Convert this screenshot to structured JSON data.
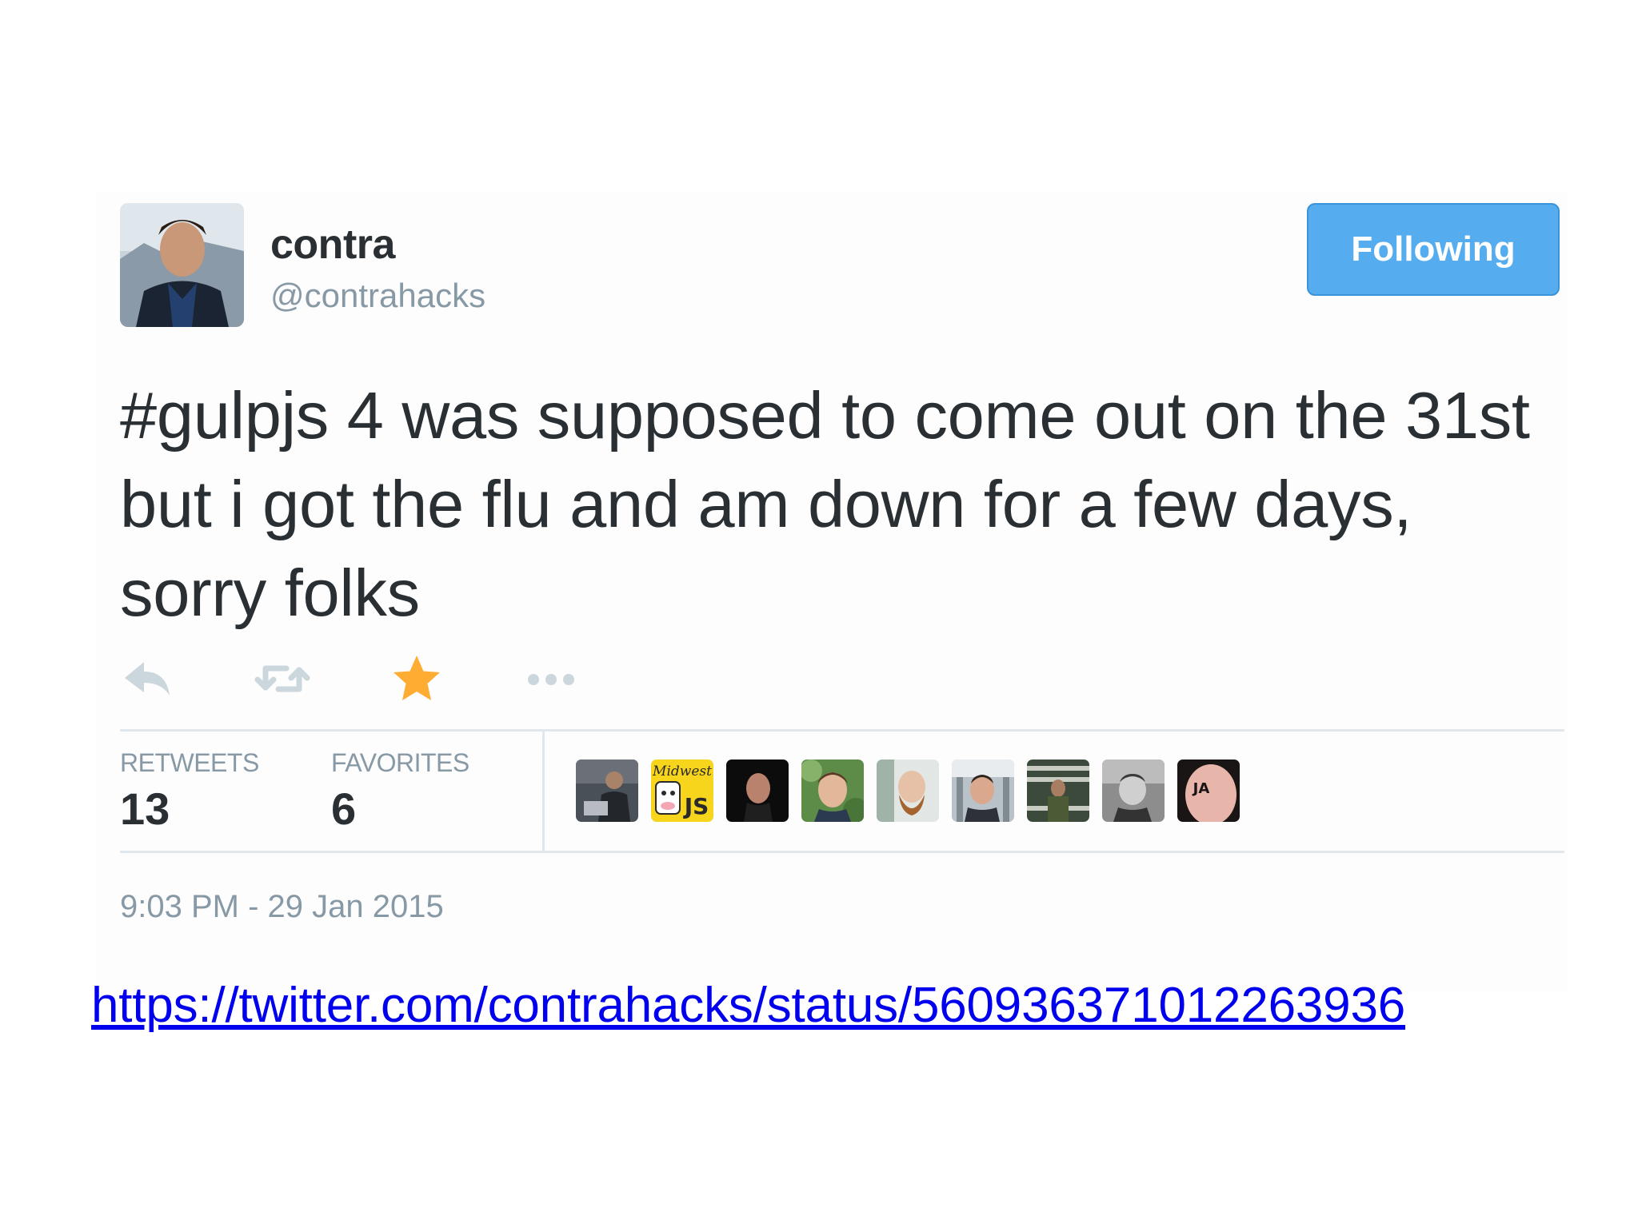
{
  "user": {
    "fullname": "contra",
    "screenname": "@contrahacks",
    "follow_button_label": "Following",
    "settings_icon": "gear-icon",
    "avatar_icon": "profile-avatar"
  },
  "tweet": {
    "hashtag": "#gulpjs",
    "text_rest": " 4 was supposed to come out on the 31st but i got the flu and am down for a few days, sorry folks",
    "timestamp": "9:03 PM - 29 Jan 2015"
  },
  "actions": {
    "items": [
      {
        "name": "reply",
        "icon": "reply-icon"
      },
      {
        "name": "retweet",
        "icon": "retweet-icon"
      },
      {
        "name": "favorite",
        "icon": "star-icon",
        "active": true
      },
      {
        "name": "more",
        "icon": "more-icon"
      }
    ],
    "favorite_color": "#ffac33",
    "inactive_color": "#ccd6dd"
  },
  "stats": {
    "retweets_label": "RETWEETS",
    "retweets_count": "13",
    "favorites_label": "FAVORITES",
    "favorites_count": "6"
  },
  "favoriters": [
    {
      "name": "favoriter-1"
    },
    {
      "name": "favoriter-2",
      "badge_text": "Midwest JS"
    },
    {
      "name": "favoriter-3"
    },
    {
      "name": "favoriter-4"
    },
    {
      "name": "favoriter-5"
    },
    {
      "name": "favoriter-6"
    },
    {
      "name": "favoriter-7"
    },
    {
      "name": "favoriter-8"
    },
    {
      "name": "favoriter-9"
    }
  ],
  "source_link": {
    "text": "https://twitter.com/contrahacks/status/560936371012263936"
  },
  "colors": {
    "button_blue": "#55acee",
    "text_dark": "#292f33",
    "text_muted": "#8899a6",
    "link_blue": "#0000ee",
    "divider": "#e1e8ed"
  }
}
